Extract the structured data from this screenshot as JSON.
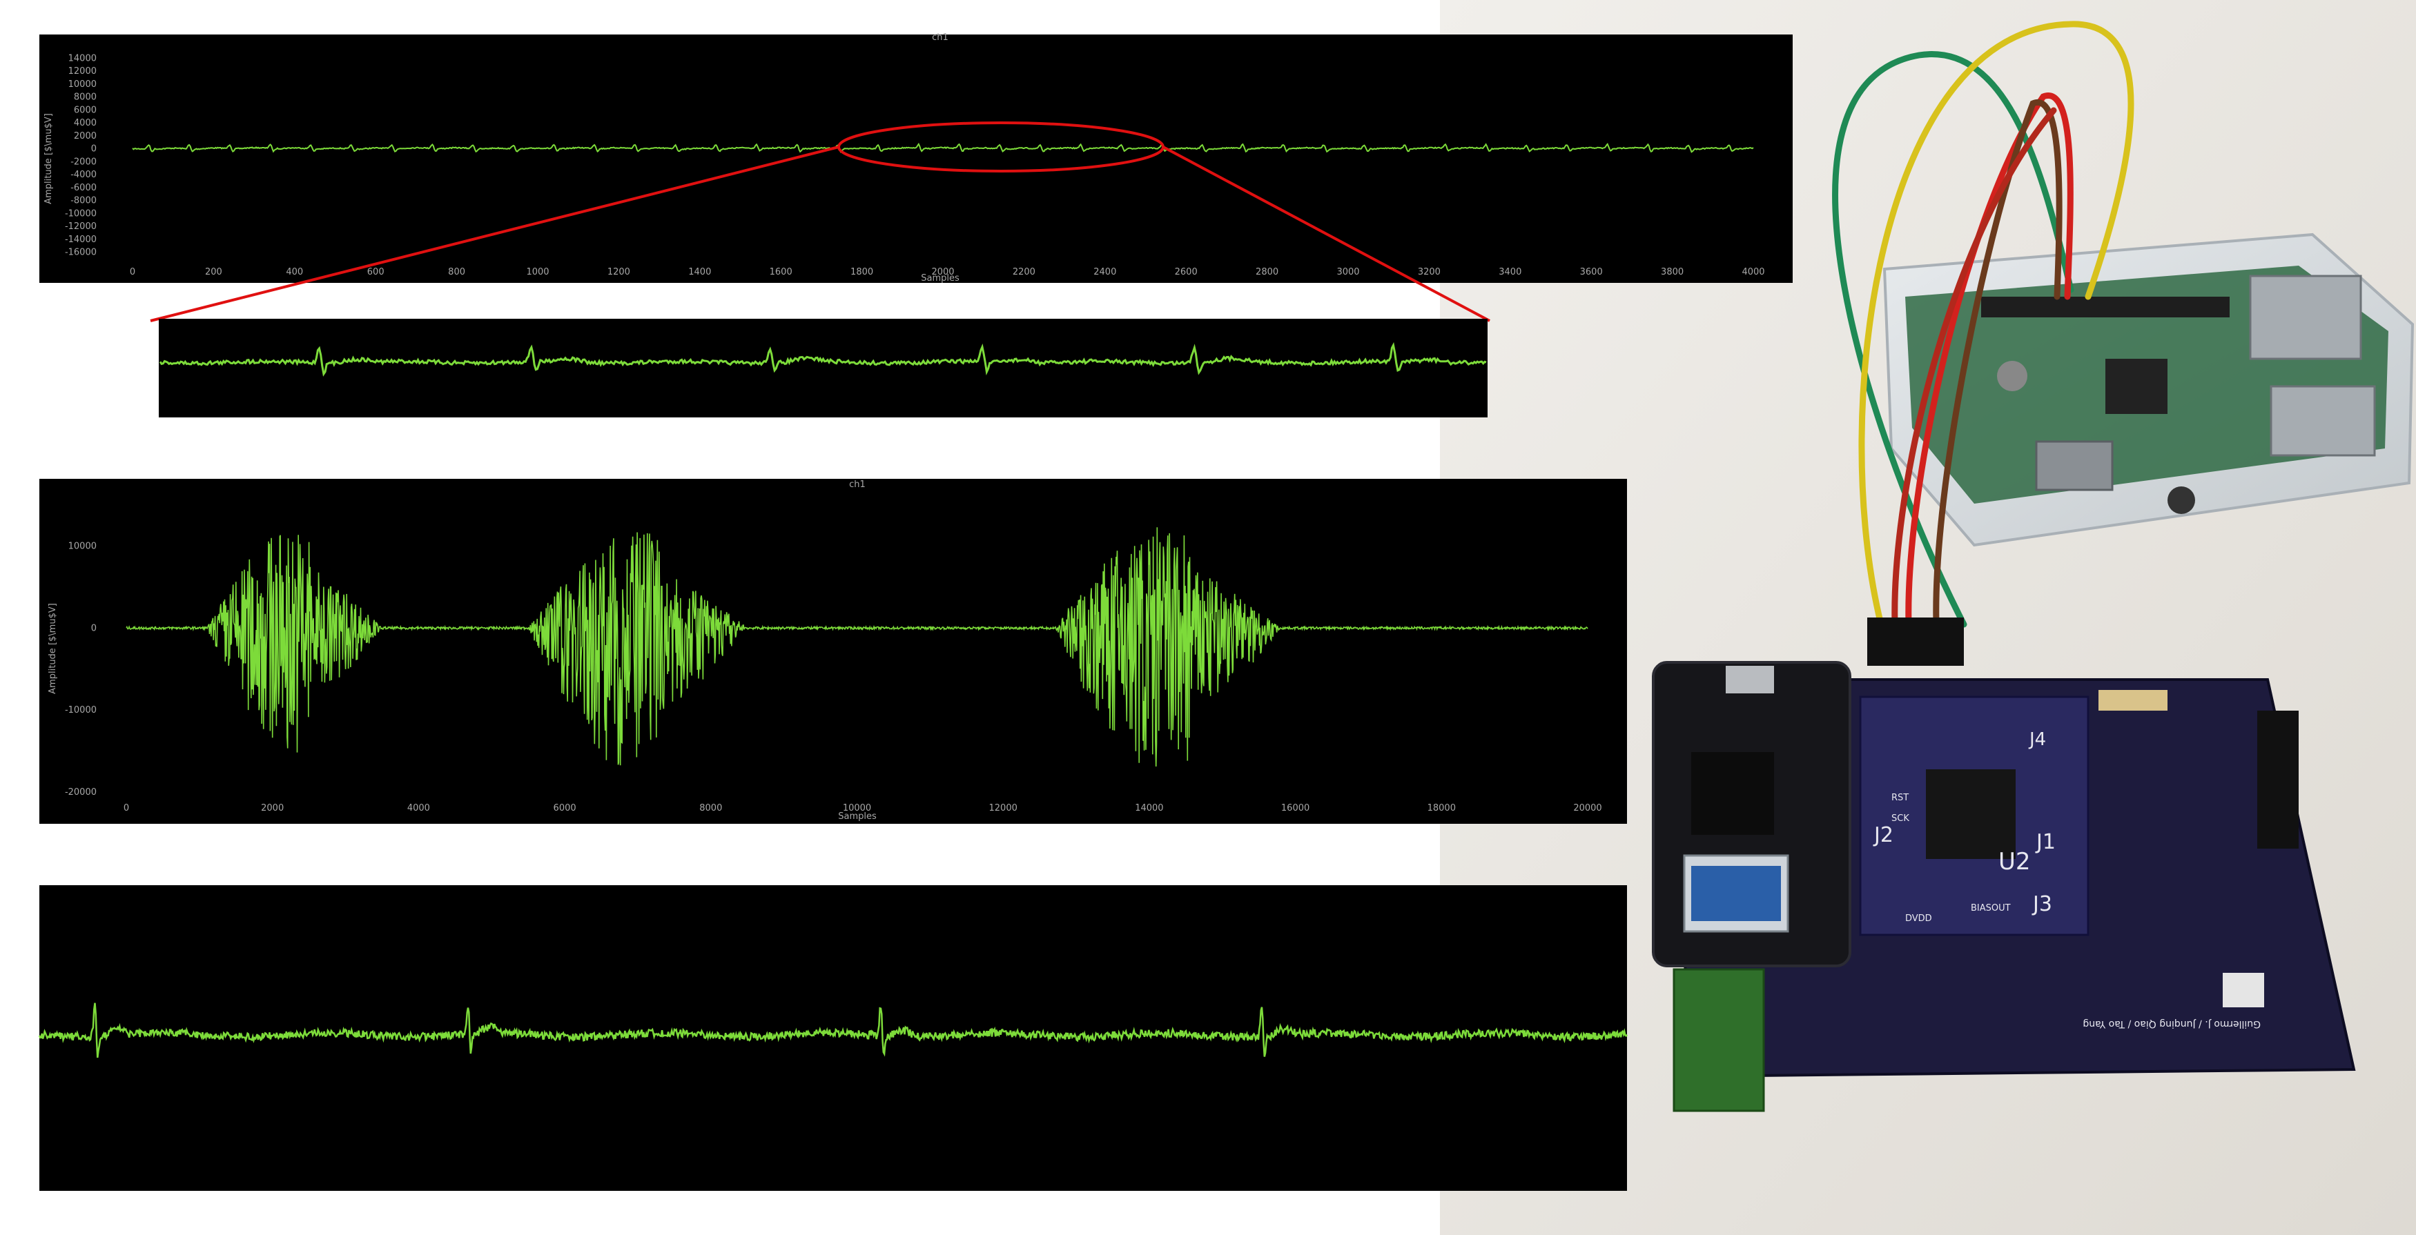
{
  "colors": {
    "signal": "#7ddb3a",
    "annotation": "#e01010",
    "axis": "#a8a8a8",
    "panel": "#000000",
    "photo_background": "#ece9e4"
  },
  "chart_data": [
    {
      "type": "line",
      "title": "ch1",
      "xlabel": "Samples",
      "ylabel": "Amplitude [$\\mu$V]",
      "xlim": [
        0,
        4000
      ],
      "ylim": [
        -17000,
        15000
      ],
      "x_ticks": [
        "0",
        "200",
        "400",
        "600",
        "800",
        "1000",
        "1200",
        "1400",
        "1600",
        "1800",
        "2000",
        "2200",
        "2400",
        "2600",
        "2800",
        "3000",
        "3200",
        "3400",
        "3600",
        "3800",
        "4000"
      ],
      "y_ticks": [
        "14000",
        "12000",
        "10000",
        "8000",
        "6000",
        "4000",
        "2000",
        "0",
        "-2000",
        "-4000",
        "-6000",
        "-8000",
        "-10000",
        "-12000",
        "-14000",
        "-16000"
      ],
      "series": [
        {
          "values": "near-zero ECG-like trace, amplitude about ±500 around 0 across samples 0–4000"
        }
      ],
      "annotation": {
        "type": "ellipse",
        "x_range": [
          1750,
          2550
        ],
        "color": "#e01010"
      }
    },
    {
      "type": "line",
      "xlim": [
        1750,
        2550
      ],
      "series": [
        {
          "values": "zoomed ECG detail of the highlighted region"
        }
      ]
    },
    {
      "type": "line",
      "title": "ch1",
      "xlabel": "Samples",
      "ylabel": "Amplitude [$\\mu$V]",
      "xlim": [
        0,
        20000
      ],
      "ylim": [
        -21000,
        16000
      ],
      "x_ticks": [
        "0",
        "2000",
        "4000",
        "6000",
        "8000",
        "10000",
        "12000",
        "14000",
        "16000",
        "18000",
        "20000"
      ],
      "y_ticks": [
        "10000",
        "0",
        "-10000",
        "-20000"
      ],
      "series": [
        {
          "bursts": [
            {
              "start": 1100,
              "end": 3500,
              "peak_pos": 14000,
              "peak_neg": -17000
            },
            {
              "start": 5500,
              "end": 8500,
              "peak_pos": 13000,
              "peak_neg": -20000
            },
            {
              "start": 12700,
              "end": 15800,
              "peak_pos": 14000,
              "peak_neg": -21000
            }
          ]
        }
      ]
    },
    {
      "type": "line",
      "series": [
        {
          "values": "ECG with four QRS complexes"
        }
      ]
    }
  ],
  "photo": {
    "board_labels": [
      "J2",
      "J1",
      "J3",
      "U2",
      "J4",
      "DVDD",
      "BIASOUT",
      "RST",
      "SCK"
    ],
    "credit": "Guillermo J. / Junqing Qiao / Tao Yang"
  }
}
